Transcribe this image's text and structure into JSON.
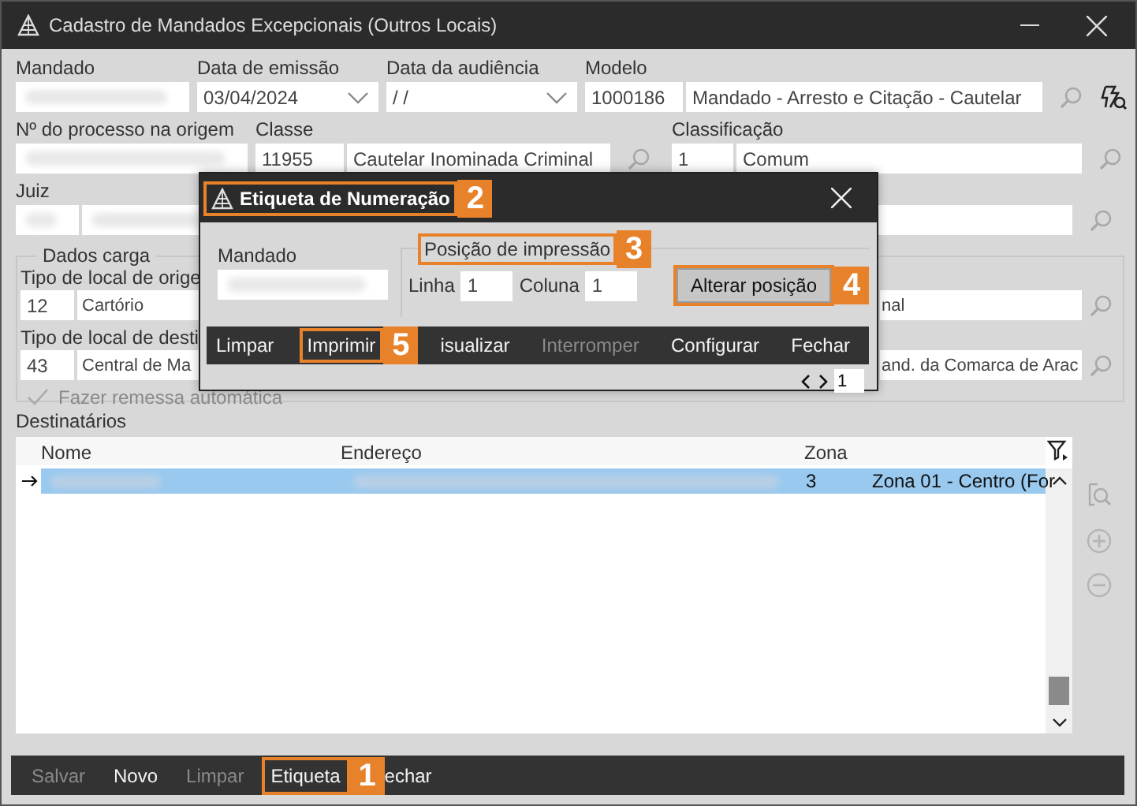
{
  "window": {
    "title": "Cadastro de Mandados Excepcionais (Outros Locais)"
  },
  "mandado": {
    "label": "Mandado"
  },
  "data_emissao": {
    "label": "Data de emissão",
    "value": "03/04/2024"
  },
  "data_audiencia": {
    "label": "Data da audiência",
    "value": "/ /"
  },
  "modelo": {
    "label": "Modelo",
    "code": "1000186",
    "value": "Mandado - Arresto e Citação - Cautelar"
  },
  "processo": {
    "label": "Nº do processo na origem"
  },
  "classe": {
    "label": "Classe",
    "code": "11955",
    "value": "Cautelar Inominada Criminal"
  },
  "classificacao": {
    "label": "Classificação",
    "code": "1",
    "value": "Comum"
  },
  "juiz": {
    "label": "Juiz"
  },
  "dados_carga": {
    "title": "Dados carga",
    "origem": {
      "label": "Tipo de local de orige",
      "code": "12",
      "value": "Cartório",
      "right_value": "nal"
    },
    "destino": {
      "label": "Tipo de local de desti",
      "code": "43",
      "value": "Central de Ma",
      "right_value": "and. da Comarca de Arac"
    },
    "remessa": {
      "label": "Fazer remessa automática",
      "checked": true,
      "disabled": true
    }
  },
  "destinatarios": {
    "label": "Destinatários",
    "columns": [
      "Nome",
      "Endereço",
      "Zona"
    ],
    "rows": [
      {
        "selected": true,
        "zona": "3",
        "zona_nome": "Zona 01 - Centro (For"
      }
    ]
  },
  "toolbar": [
    {
      "label": "Salvar",
      "disabled": true
    },
    {
      "label": "Novo",
      "disabled": false
    },
    {
      "label": "Limpar",
      "disabled": true
    },
    {
      "label": "Etiqueta",
      "disabled": false,
      "annotation": "1"
    },
    {
      "label": "echar",
      "disabled": false
    }
  ],
  "dialog": {
    "title": "Etiqueta de Numeração",
    "title_annotation": "2",
    "mandado_label": "Mandado",
    "group_title": "Posição de impressão",
    "group_annotation": "3",
    "linha": {
      "label": "Linha",
      "value": "1"
    },
    "coluna": {
      "label": "Coluna",
      "value": "1"
    },
    "alterar": {
      "label": "Alterar posição",
      "annotation": "4"
    },
    "toolbar": [
      {
        "label": "Limpar",
        "disabled": false
      },
      {
        "label": "Imprimir",
        "disabled": false,
        "annotation": "5"
      },
      {
        "label": "isualizar",
        "disabled": false
      },
      {
        "label": "Interromper",
        "disabled": true
      },
      {
        "label": "Configurar",
        "disabled": false
      },
      {
        "label": "Fechar",
        "disabled": false
      }
    ],
    "page": "1"
  }
}
